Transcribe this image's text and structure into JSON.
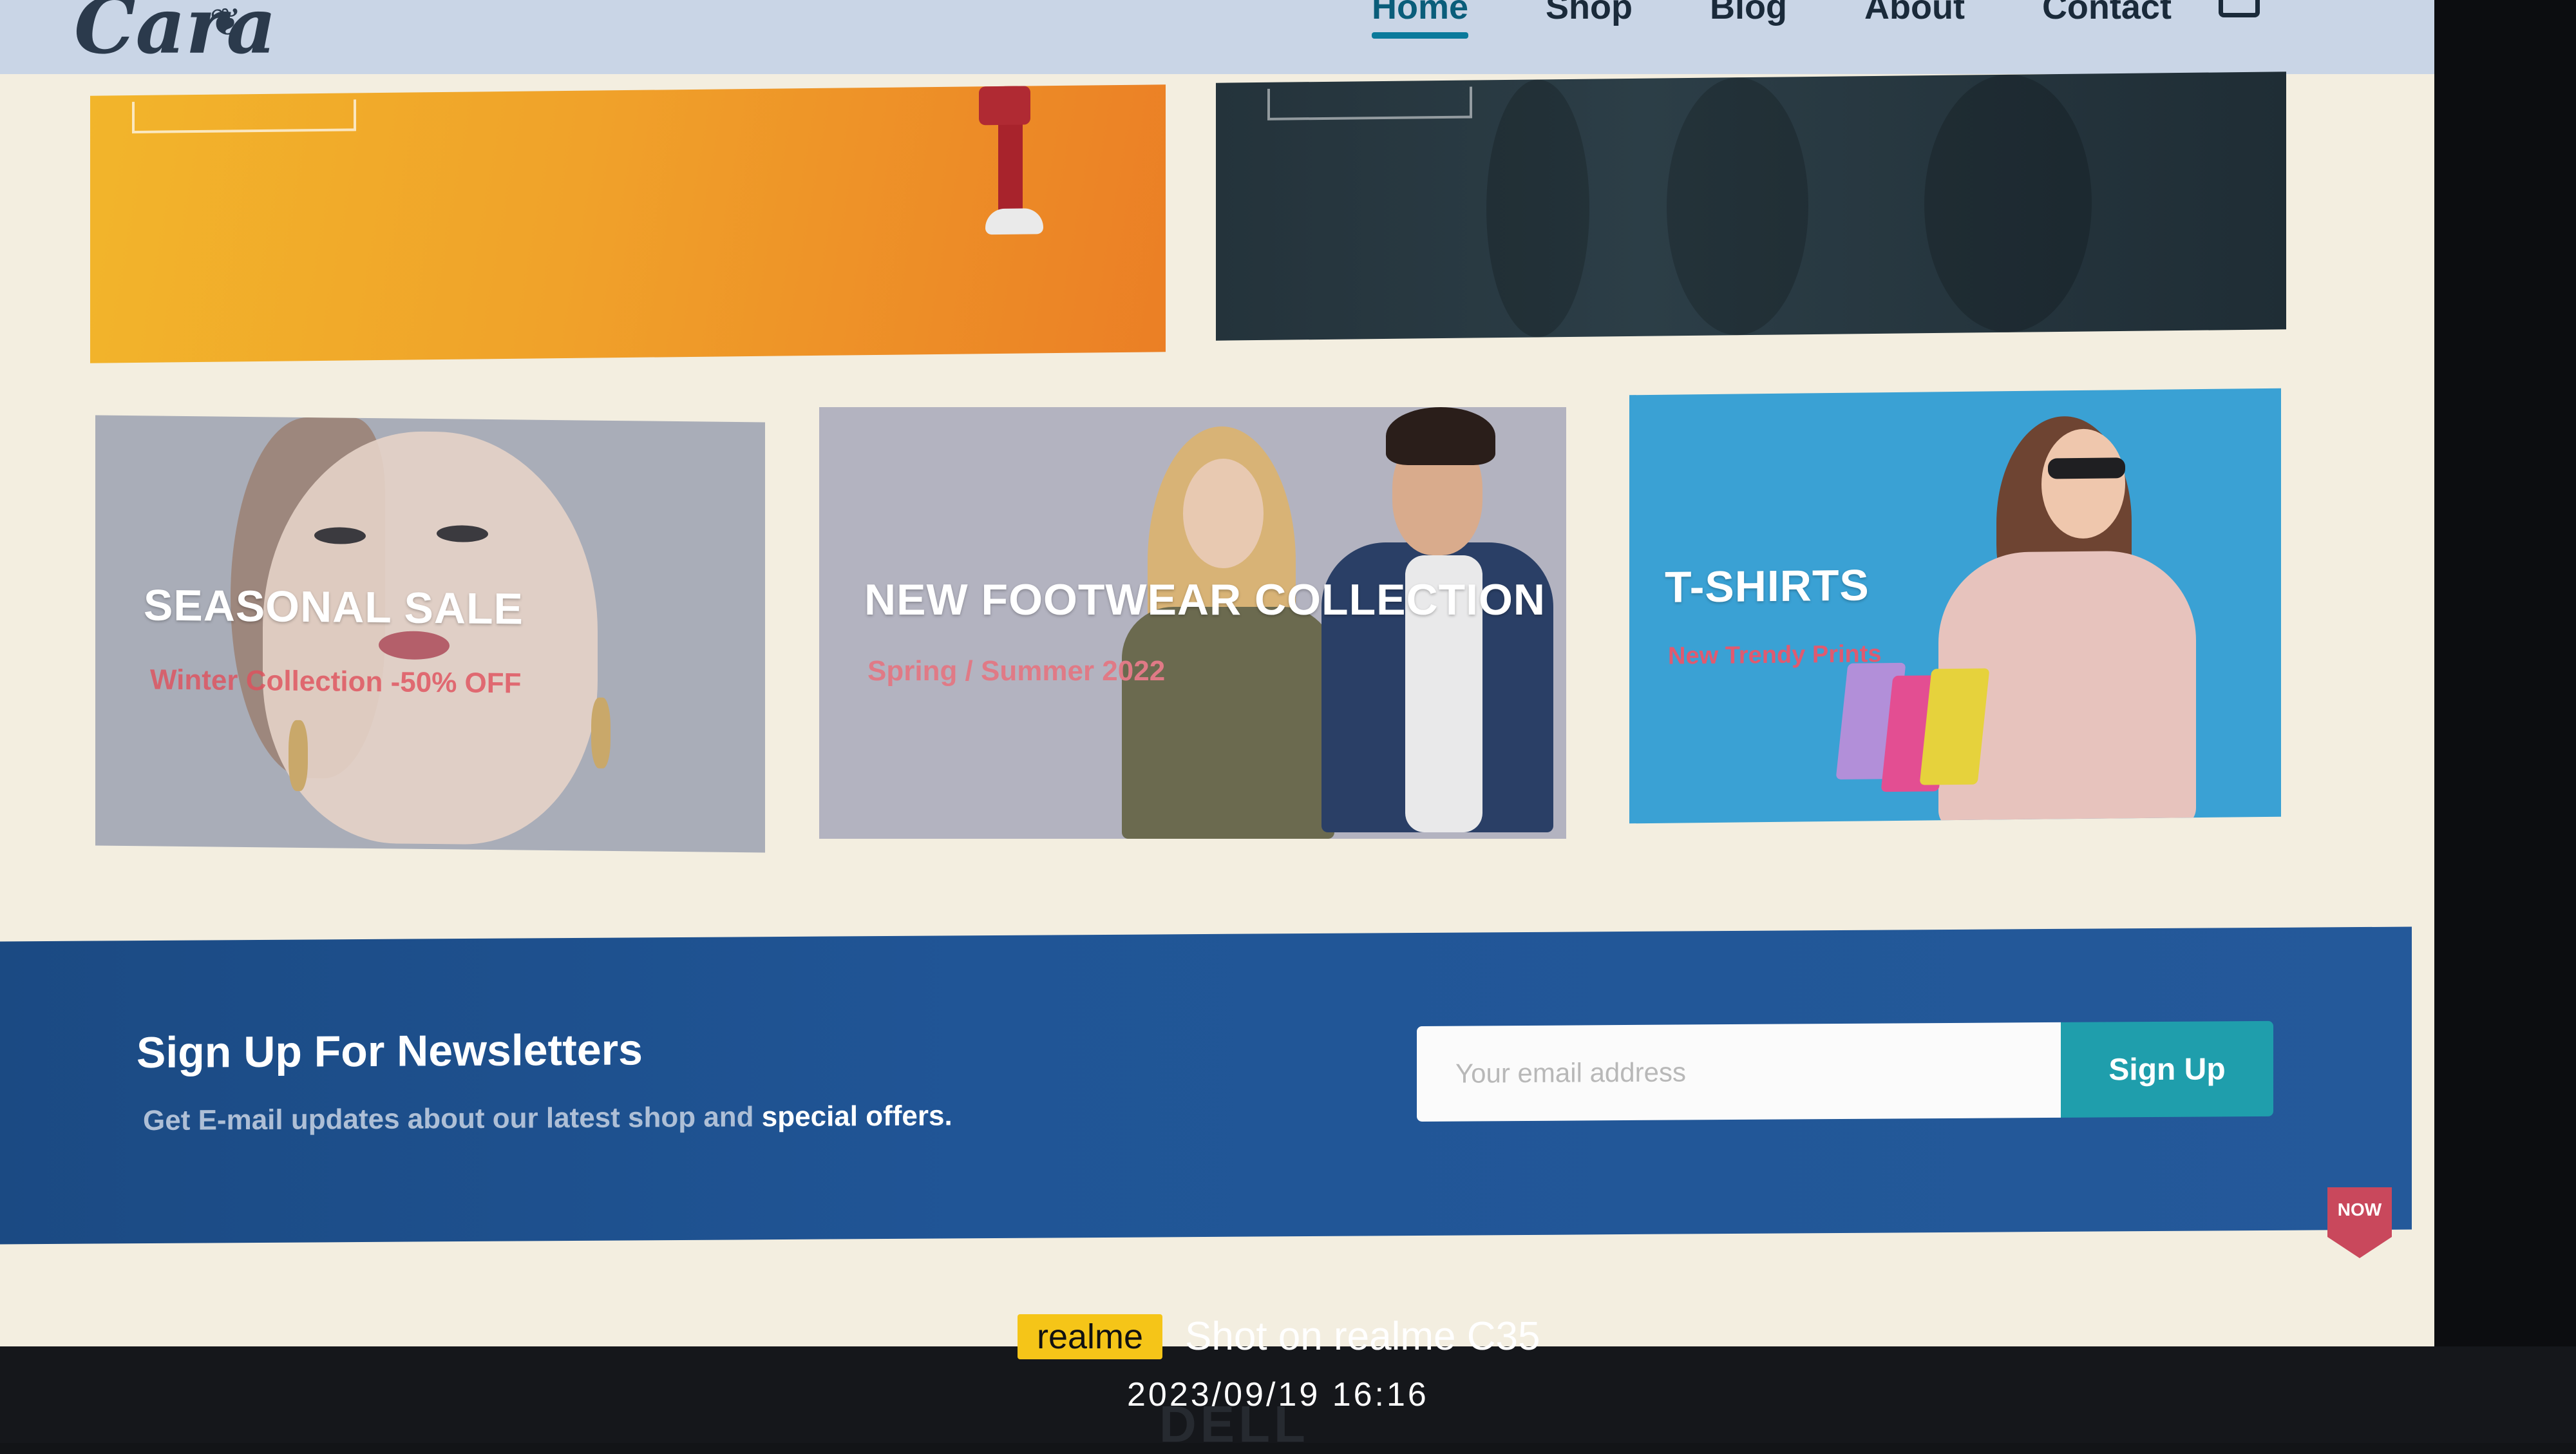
{
  "header": {
    "logo": "Cara",
    "nav": [
      "Home",
      "Shop",
      "Blog",
      "About",
      "Contact"
    ],
    "active_nav": "Home"
  },
  "cards": [
    {
      "title": "SEASONAL SALE",
      "subtitle": "Winter Collection -50% OFF",
      "sub_color": "#e0505c"
    },
    {
      "title": "NEW FOOTWEAR COLLECTION",
      "subtitle": "Spring / Summer 2022",
      "sub_color": "#e07a86"
    },
    {
      "title": "T-SHIRTS",
      "subtitle": "New Trendy Prints",
      "sub_color": "#e05a70"
    }
  ],
  "newsletter": {
    "title": "Sign Up For Newsletters",
    "desc_prefix": "Get E-mail updates about our latest shop and",
    "desc_highlight": "special offers.",
    "placeholder": "Your email address",
    "button": "Sign Up",
    "badge": "NOW"
  },
  "watermark": {
    "brand": "realme",
    "shot": "Shot on realme C35",
    "datetime": "2023/09/19  16:16",
    "monitor_brand": "DELL"
  },
  "colors": {
    "newsletter_bg": "#205596",
    "signup_button": "#1f9eac",
    "header_bg": "#c9d5e6"
  }
}
